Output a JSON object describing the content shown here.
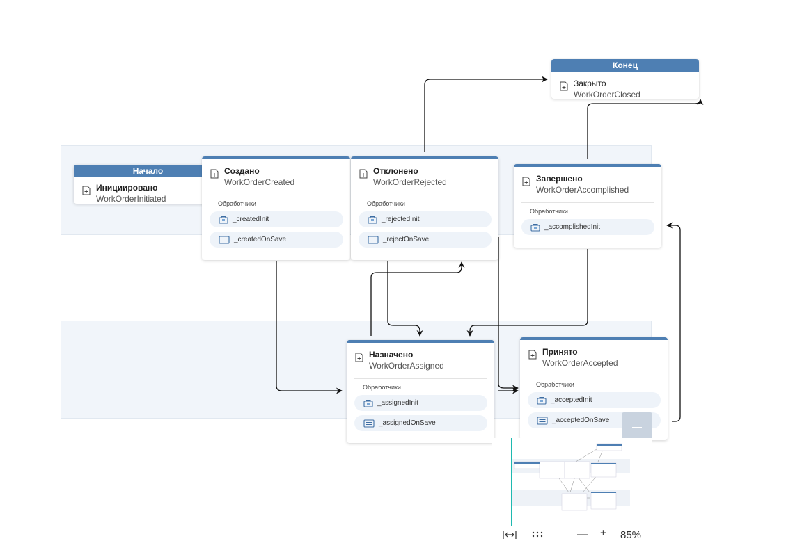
{
  "lanes": [
    {
      "id": "lane-top"
    },
    {
      "id": "lane-bottom"
    }
  ],
  "nodes": {
    "start": {
      "header": "Начало",
      "name": "Инициировано",
      "code": "WorkOrderInitiated"
    },
    "end": {
      "header": "Конец",
      "name": "Закрыто",
      "code": "WorkOrderClosed"
    },
    "created": {
      "name": "Создано",
      "code": "WorkOrderCreated",
      "handlers_label": "Обработчики",
      "handlers": [
        {
          "name": "_createdInit",
          "icon": "init-icon"
        },
        {
          "name": "_createdOnSave",
          "icon": "save-form-icon"
        }
      ]
    },
    "rejected": {
      "name": "Отклонено",
      "code": "WorkOrderRejected",
      "handlers_label": "Обработчики",
      "handlers": [
        {
          "name": "_rejectedInit",
          "icon": "init-icon"
        },
        {
          "name": "_rejectOnSave",
          "icon": "save-form-icon"
        }
      ]
    },
    "accomplished": {
      "name": "Завершено",
      "code": "WorkOrderAccomplished",
      "handlers_label": "Обработчики",
      "handlers": [
        {
          "name": "_accomplishedInit",
          "icon": "init-icon"
        }
      ]
    },
    "assigned": {
      "name": "Назначено",
      "code": "WorkOrderAssigned",
      "handlers_label": "Обработчики",
      "handlers": [
        {
          "name": "_assignedInit",
          "icon": "init-icon"
        },
        {
          "name": "_assignedOnSave",
          "icon": "save-form-icon"
        }
      ]
    },
    "accepted": {
      "name": "Принято",
      "code": "WorkOrderAccepted",
      "handlers_label": "Обработчики",
      "handlers": [
        {
          "name": "_acceptedInit",
          "icon": "init-icon"
        },
        {
          "name": "_acceptedOnSave",
          "icon": "save-form-icon"
        }
      ]
    }
  },
  "edges": [
    {
      "from": "rejected",
      "to": "end"
    },
    {
      "from": "accomplished",
      "to": "end"
    },
    {
      "from": "created",
      "to": "assigned"
    },
    {
      "from": "assigned",
      "to": "rejected"
    },
    {
      "from": "rejected",
      "to": "assigned"
    },
    {
      "from": "accomplished",
      "to": "assigned"
    },
    {
      "from": "rejected",
      "to": "accepted"
    },
    {
      "from": "assigned",
      "to": "accepted"
    },
    {
      "from": "accepted",
      "to": "accomplished"
    }
  ],
  "toolbar": {
    "fit_icon": "fit-width-icon",
    "grid_icon": "grid-dots-icon",
    "zoom_out_label": "—",
    "zoom_in_label": "+",
    "zoom_level": "85%"
  },
  "colors": {
    "header": "#4e7fb3",
    "lane": "#f1f5fa",
    "handler_bg": "#eef3f9",
    "minimap_bar": "#1fb9b0"
  }
}
